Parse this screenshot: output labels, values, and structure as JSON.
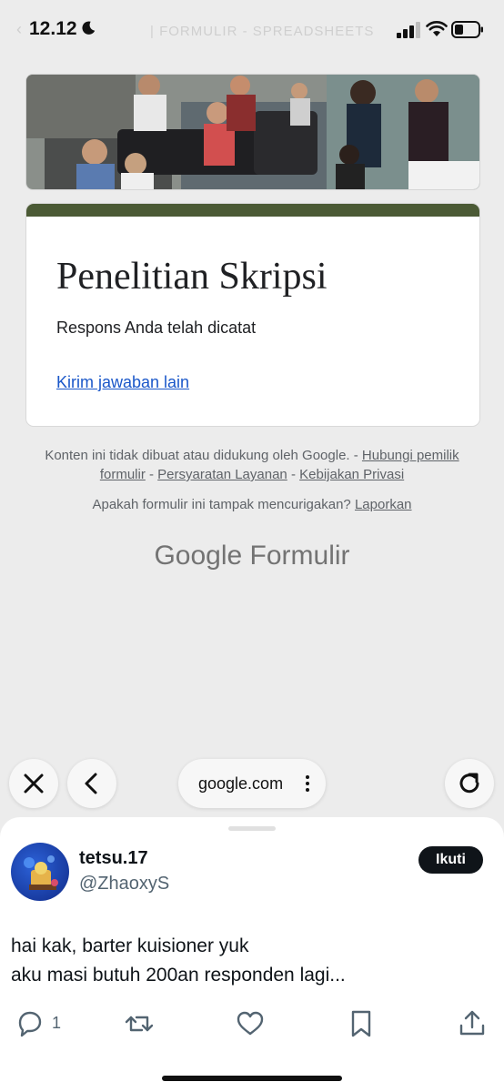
{
  "status_bar": {
    "time": "12.12"
  },
  "browser": {
    "ghost_tab_text": "| FORMULIR - SPREADSHEETS",
    "url": "google.com"
  },
  "form": {
    "title": "Penelitian Skripsi",
    "response_message": "Respons Anda telah dicatat",
    "another_response_link": "Kirim jawaban lain",
    "accent_color": "#4b5a35"
  },
  "footer": {
    "disclaimer": "Konten ini tidak dibuat atau didukung oleh Google. -",
    "contact_owner": "Hubungi pemilik formulir",
    "terms": "Persyaratan Layanan",
    "privacy": "Kebijakan Privasi",
    "suspicious_question": "Apakah formulir ini tampak mencurigakan?",
    "report": "Laporkan",
    "brand_google": "Google",
    "brand_forms": "Formulir"
  },
  "tweet": {
    "display_name": "tetsu.17",
    "handle": "@ZhaoxyS",
    "follow_label": "Ikuti",
    "line1": "hai kak, barter kuisioner yuk",
    "line2": "aku masi butuh 200an responden lagi...",
    "reply_count": "1"
  },
  "icons": [
    "moon-icon",
    "signal-icon",
    "wifi-icon",
    "battery-icon",
    "close-icon",
    "back-icon",
    "more-icon",
    "reload-icon",
    "reply-icon",
    "retweet-icon",
    "like-icon",
    "bookmark-icon",
    "share-icon"
  ]
}
